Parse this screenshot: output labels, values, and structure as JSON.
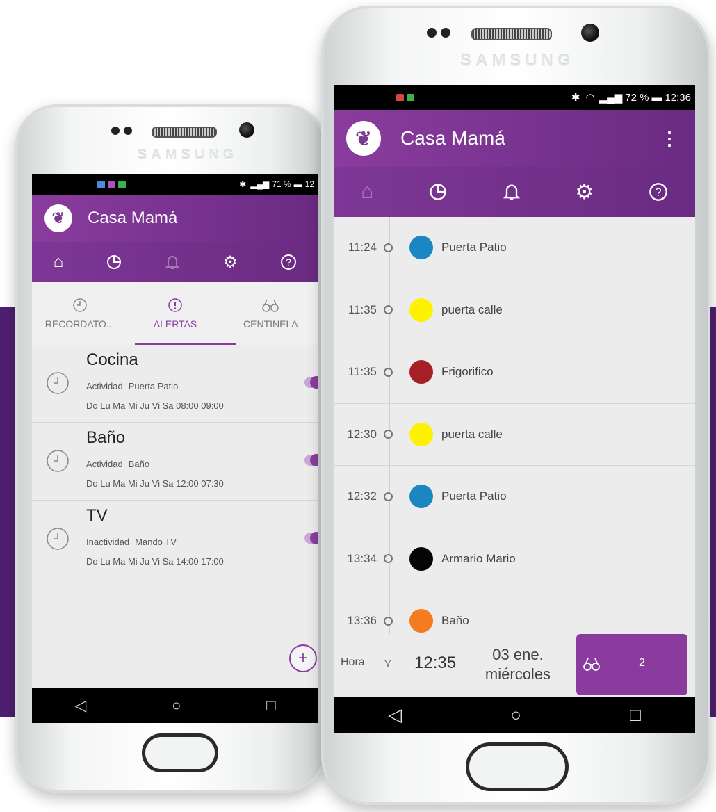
{
  "brand": "SAMSUNG",
  "colors": {
    "accent": "#8a3c9e",
    "background_band": "#4f1f70"
  },
  "phone_left": {
    "status": {
      "battery": "71 %",
      "time": "12"
    },
    "app_title": "Casa Mamá",
    "subtabs": [
      {
        "label": "RECORDATO...",
        "icon": "clock-icon",
        "active": false
      },
      {
        "label": "ALERTAS",
        "icon": "alert-icon",
        "active": true
      },
      {
        "label": "CENTINELA",
        "icon": "binoculars-icon",
        "active": false
      }
    ],
    "alerts": [
      {
        "title": "Cocina",
        "type": "Actividad",
        "device": "Puerta Patio",
        "schedule": "Do Lu Ma Mi Ju Vi Sa 08:00 09:00",
        "enabled": true
      },
      {
        "title": "Baño",
        "type": "Actividad",
        "device": "Baño",
        "schedule": "Do Lu Ma Mi Ju Vi Sa 12:00 07:30",
        "enabled": true
      },
      {
        "title": "TV",
        "type": "Inactividad",
        "device": "Mando TV",
        "schedule": "Do Lu Ma Mi Ju Vi Sa 14:00 17:00",
        "enabled": true
      }
    ],
    "fab_label": "+"
  },
  "phone_right": {
    "status": {
      "battery": "72 %",
      "time": "12:36"
    },
    "app_title": "Casa Mamá",
    "events": [
      {
        "time": "11:24",
        "label": "Puerta Patio",
        "color": "#1a86c2"
      },
      {
        "time": "11:35",
        "label": "puerta calle",
        "color": "#fff200"
      },
      {
        "time": "11:35",
        "label": "Frigorifico",
        "color": "#a51f24"
      },
      {
        "time": "12:30",
        "label": "puerta calle",
        "color": "#fff200"
      },
      {
        "time": "12:32",
        "label": "Puerta Patio",
        "color": "#1a86c2"
      },
      {
        "time": "13:34",
        "label": "Armario Mario",
        "color": "#050505"
      },
      {
        "time": "13:36",
        "label": "Baño",
        "color": "#f47b20"
      }
    ],
    "bottom": {
      "hora_label": "Hora",
      "time": "12:35",
      "date_line1": "03 ene.",
      "date_line2": "miércoles",
      "count": "2"
    }
  }
}
